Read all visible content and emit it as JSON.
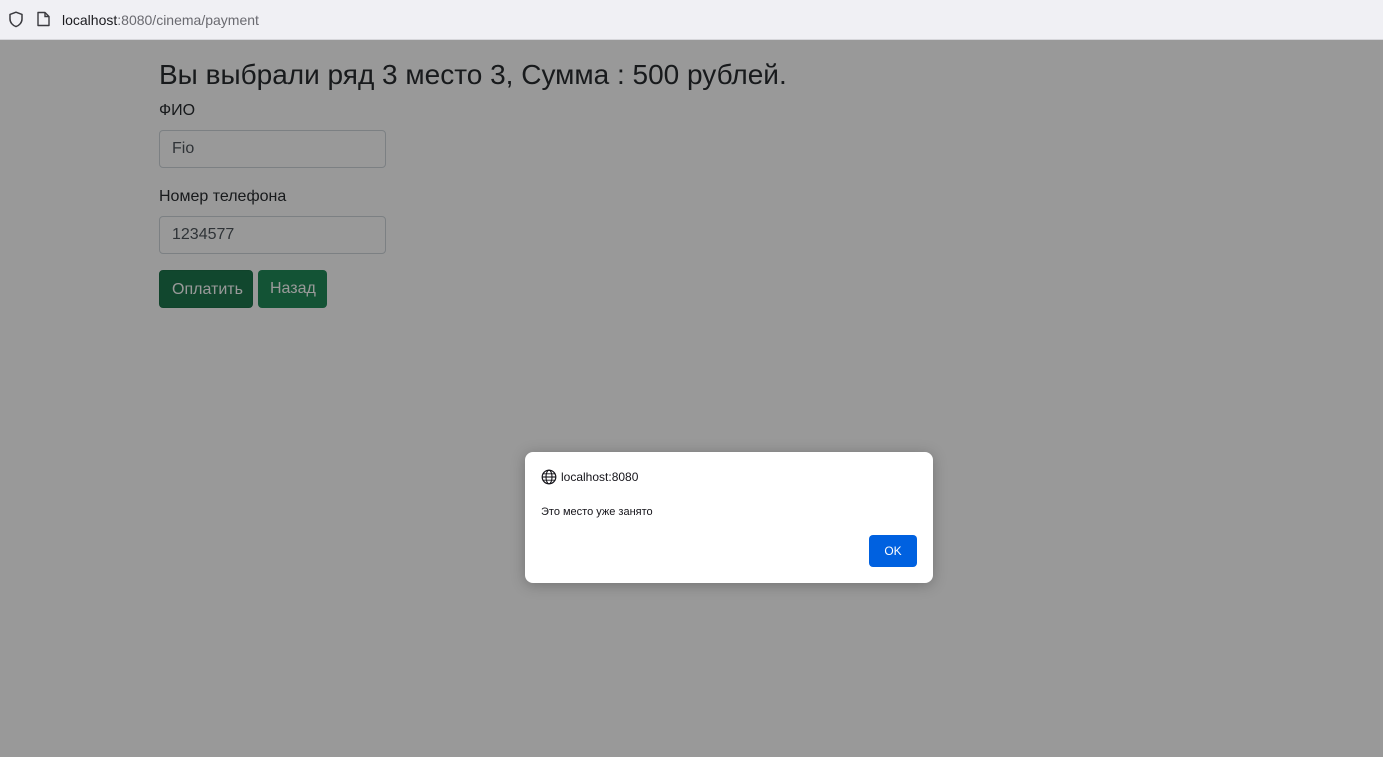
{
  "browser": {
    "url_host": "localhost",
    "url_rest": ":8080/cinema/payment"
  },
  "page": {
    "heading": "Вы выбрали ряд 3 место 3, Сумма : 500 рублей.",
    "fio_label": "ФИО",
    "fio_value": "Fio",
    "phone_label": "Номер телефона",
    "phone_value": "1234577",
    "pay_button": "Оплатить",
    "back_button": "Назад"
  },
  "dialog": {
    "origin": "localhost:8080",
    "message": "Это место уже занято",
    "ok_button": "OK"
  },
  "colors": {
    "primary_green": "#198754",
    "dialog_button_blue": "#0061e0"
  }
}
